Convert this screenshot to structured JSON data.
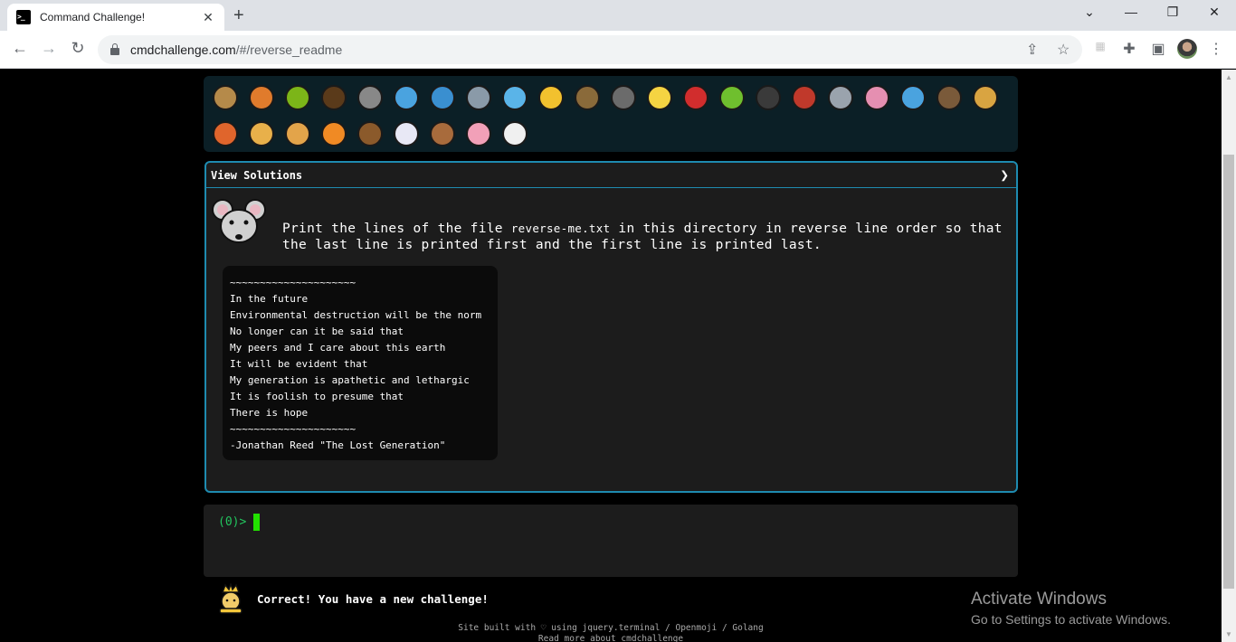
{
  "browser": {
    "tab_title": "Command Challenge!",
    "url_host": "cmdchallenge.com",
    "url_path": "/#/reverse_readme",
    "new_tab": "+",
    "tab_close": "✕",
    "win_minimize": "⌄",
    "win_min": "—",
    "win_restore": "❐",
    "win_close": "✕",
    "icons": [
      "back-icon",
      "forward-icon",
      "reload-icon",
      "share-icon",
      "star-icon",
      "extension-placeholder-icon",
      "puzzle-icon",
      "side-panel-icon",
      "avatar",
      "kebab-menu-icon"
    ]
  },
  "animals": [
    {
      "name": "snail",
      "color": "#b58a4a"
    },
    {
      "name": "butterfly",
      "color": "#e07b2c"
    },
    {
      "name": "caterpillar",
      "color": "#7cb518"
    },
    {
      "name": "ant",
      "color": "#5a3a1a"
    },
    {
      "name": "spider-web",
      "color": "#888888"
    },
    {
      "name": "whale",
      "color": "#4aa3df"
    },
    {
      "name": "dolphin",
      "color": "#3a8fd0"
    },
    {
      "name": "shark",
      "color": "#8a9aa8"
    },
    {
      "name": "fish",
      "color": "#5ab4e8"
    },
    {
      "name": "tropical-fish",
      "color": "#f2c12e"
    },
    {
      "name": "blowfish",
      "color": "#8a6a3a"
    },
    {
      "name": "wolf",
      "color": "#6b6b6b"
    },
    {
      "name": "bee",
      "color": "#f5d442"
    },
    {
      "name": "ladybug",
      "color": "#d12d2d"
    },
    {
      "name": "lizard",
      "color": "#6fbf2e"
    },
    {
      "name": "mosquito",
      "color": "#3a3a3a"
    },
    {
      "name": "scorpion",
      "color": "#c0392b"
    },
    {
      "name": "fly",
      "color": "#9aa3ad"
    },
    {
      "name": "worm",
      "color": "#e58fb1"
    },
    {
      "name": "microbe",
      "color": "#4aa3df"
    },
    {
      "name": "monkey",
      "color": "#7a5a3a"
    },
    {
      "name": "dog",
      "color": "#d9a441"
    },
    {
      "name": "fox",
      "color": "#e0652c"
    },
    {
      "name": "cat",
      "color": "#e8b04a"
    },
    {
      "name": "lion",
      "color": "#e3a44a"
    },
    {
      "name": "tiger",
      "color": "#f08a24"
    },
    {
      "name": "horse",
      "color": "#8b5a2b"
    },
    {
      "name": "unicorn",
      "color": "#e8e8f5"
    },
    {
      "name": "cow",
      "color": "#a86b3c"
    },
    {
      "name": "pig",
      "color": "#f2a0b8"
    },
    {
      "name": "mouse",
      "color": "#f0f0f0"
    }
  ],
  "panel": {
    "header": "View Solutions",
    "chevron": "❯",
    "challenge_before": "Print the lines of the file ",
    "challenge_file": "reverse-me.txt",
    "challenge_after": " in this directory in reverse line order so that the last line is printed first and the first line is printed last.",
    "file_lines": [
      "~~~~~~~~~~~~~~~~~~~~~",
      "In the future",
      "Environmental destruction will be the norm",
      "No longer can it be said that",
      "My peers and I care about this earth",
      "It will be evident that",
      "My generation is apathetic and lethargic",
      "It is foolish to presume that",
      "There is hope",
      "~~~~~~~~~~~~~~~~~~~~~",
      "-Jonathan Reed \"The Lost Generation\""
    ]
  },
  "terminal": {
    "prompt": "(0)>"
  },
  "status": {
    "message": "Correct! You have a new challenge!"
  },
  "footer": {
    "line1": "Site built with ♡ using jquery.terminal / Openmoji / Golang",
    "line2": "Read more about cmdchallenge"
  },
  "watermark": {
    "title": "Activate Windows",
    "subtitle": "Go to Settings to activate Windows."
  }
}
